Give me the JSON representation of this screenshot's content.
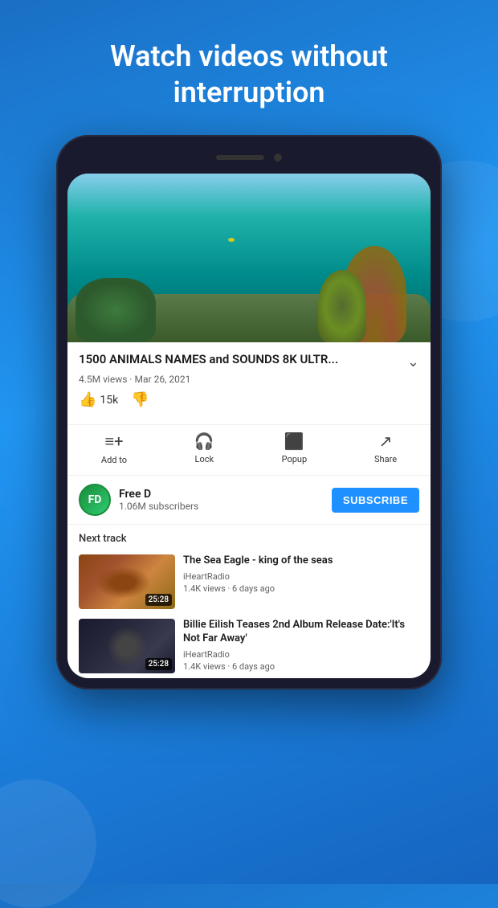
{
  "hero": {
    "title": "Watch videos without interruption"
  },
  "video": {
    "title": "1500 ANIMALS NAMES and SOUNDS 8K ULTR...",
    "views": "4.5M views",
    "date": "Mar 26, 2021",
    "likes": "15k"
  },
  "actions": {
    "add_to": "Add to",
    "lock": "Lock",
    "popup": "Popup",
    "share": "Share"
  },
  "channel": {
    "name": "Free D",
    "subscribers": "1.06M subscribers",
    "subscribe_label": "SUBSCRIBE",
    "avatar_letter": "FD"
  },
  "next_track": {
    "label": "Next track",
    "items": [
      {
        "title": "The Sea Eagle - king of the seas",
        "channel": "iHeartRadio",
        "meta": "1.4K views · 6 days ago",
        "duration": "25:28"
      },
      {
        "title": "Billie Eilish Teases 2nd Album Release Date:'It's Not Far Away'",
        "channel": "iHeartRadio",
        "meta": "1.4K views · 6 days ago",
        "duration": "25:28"
      }
    ]
  }
}
